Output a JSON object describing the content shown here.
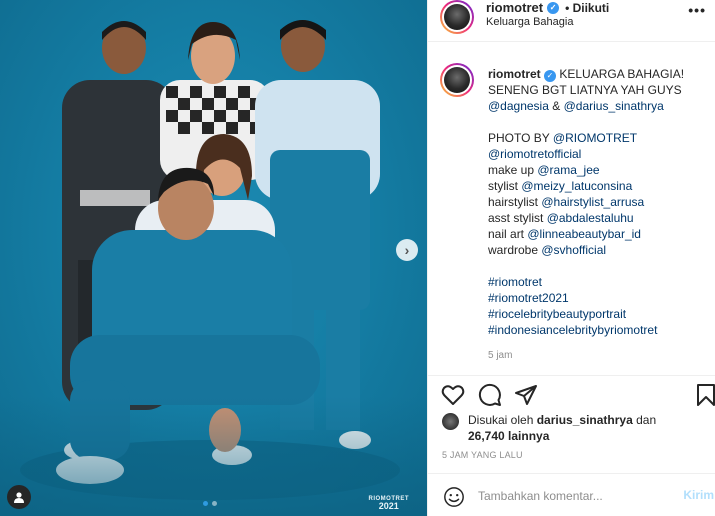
{
  "colors": {
    "photo_bg": "#157fa6",
    "link": "#00376b",
    "verified": "#3897f0",
    "post_button": "#b2dffc"
  },
  "photo": {
    "watermark_name": "RIOMOTRET",
    "watermark_year": "2021",
    "next_icon": "chevron-right-icon",
    "tag_icon": "user-tag-icon",
    "carousel_total": 2,
    "carousel_active": 1
  },
  "header": {
    "username": "riomotret",
    "follow_status": "• Diikuti",
    "location": "Keluarga Bahagia",
    "more": "•••"
  },
  "caption": {
    "username": "riomotret",
    "line1_rest": "KELUARGA BAHAGIA!",
    "line2": "SENENG BGT LIATNYA YAH GUYS",
    "mention1": "@dagnesia",
    "amp": "&",
    "mention2": "@darius_sinathrya",
    "credits": [
      {
        "label": "PHOTO BY ",
        "handle": "@RIOMOTRET"
      },
      {
        "label": "",
        "handle": "@riomotretofficial"
      },
      {
        "label": "make up ",
        "handle": "@rama_jee"
      },
      {
        "label": "stylist ",
        "handle": "@meizy_latuconsina"
      },
      {
        "label": "hairstylist ",
        "handle": "@hairstylist_arrusa"
      },
      {
        "label": "asst stylist ",
        "handle": "@abdalestaluhu"
      },
      {
        "label": "nail art ",
        "handle": "@linneabeautybar_id"
      },
      {
        "label": "wardrobe ",
        "handle": "@svhofficial"
      }
    ],
    "hashtags": [
      "#riomotret",
      "#riomotret2021",
      "#riocelebritybeautyportrait",
      "#indonesiancelebritybyriomotret"
    ],
    "time": "5 jam"
  },
  "actions": {
    "like_icon": "heart-icon",
    "comment_icon": "comment-icon",
    "share_icon": "share-icon",
    "save_icon": "bookmark-icon"
  },
  "likes": {
    "prefix": "Disukai oleh",
    "user": "darius_sinathrya",
    "and": "dan",
    "count": "26,740 lainnya"
  },
  "posted": "5 JAM YANG LALU",
  "comment": {
    "placeholder": "Tambahkan komentar...",
    "post_label": "Kirim",
    "emoji_icon": "emoji-icon"
  }
}
